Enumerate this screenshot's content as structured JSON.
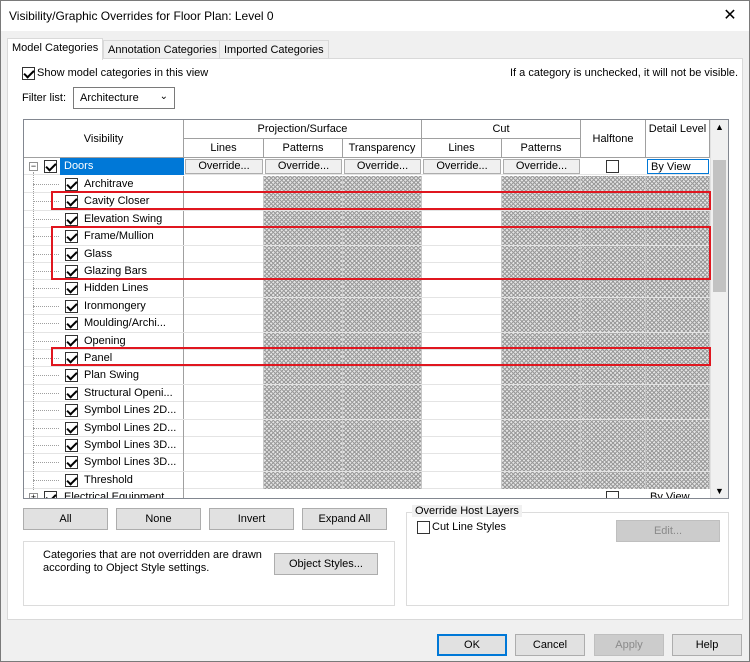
{
  "window": {
    "title": "Visibility/Graphic Overrides for Floor Plan: Level 0",
    "close_glyph": "✕"
  },
  "tabs": [
    "Model Categories",
    "Annotation Categories",
    "Imported Categories"
  ],
  "show_categories": {
    "label": "Show model categories in this view",
    "checked": true
  },
  "hint": "If a category is unchecked, it will not be visible.",
  "filter": {
    "label": "Filter list:",
    "value": "Architecture"
  },
  "table": {
    "headers": {
      "visibility": "Visibility",
      "projection_surface": "Projection/Surface",
      "cut": "Cut",
      "halftone": "Halftone",
      "detail_level": "Detail Level",
      "lines": "Lines",
      "patterns": "Patterns",
      "transparency": "Transparency",
      "cut_lines": "Lines",
      "cut_patterns": "Patterns"
    },
    "override_label": "Override...",
    "parent": {
      "name": "Doors",
      "detail": "By View",
      "expander": "−"
    },
    "subcategories": [
      "Architrave",
      "Cavity Closer",
      "Elevation Swing",
      "Frame/Mullion",
      "Glass",
      "Glazing Bars",
      "Hidden Lines",
      "Ironmongery",
      "Moulding/Archi...",
      "Opening",
      "Panel",
      "Plan Swing",
      "Structural Openi...",
      "Symbol Lines 2D...",
      "Symbol Lines 2D...",
      "Symbol Lines 3D...",
      "Symbol Lines 3D...",
      "Threshold"
    ],
    "last_row": {
      "name": "Electrical Equipment",
      "detail": "By View",
      "expander": "+"
    }
  },
  "buttons": {
    "all": "All",
    "none": "None",
    "invert": "Invert",
    "expand_all": "Expand All"
  },
  "info_text": "Categories that are not overridden are drawn according to Object Style settings.",
  "object_styles_label": "Object Styles...",
  "override_host": {
    "title": "Override Host Layers",
    "cut_line_styles": "Cut Line Styles",
    "edit": "Edit..."
  },
  "footer": {
    "ok": "OK",
    "cancel": "Cancel",
    "apply": "Apply",
    "help": "Help"
  },
  "colors": {
    "highlight_border": "#e0161f",
    "selected_row": "#0078d7"
  }
}
